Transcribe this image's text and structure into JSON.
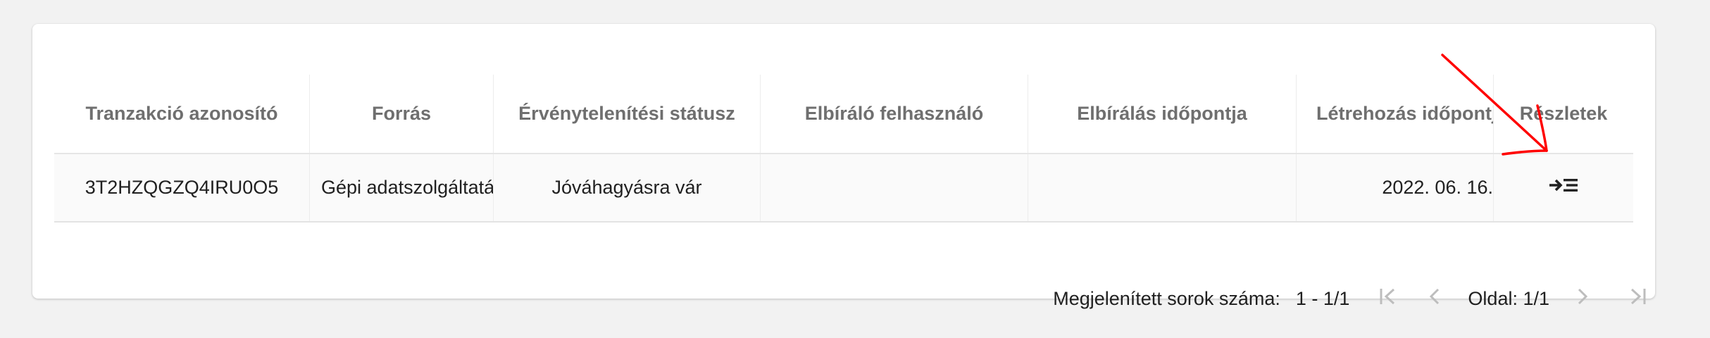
{
  "table": {
    "headers": [
      "Tranzakció azonosító",
      "Forrás",
      "Érvénytelenítési státusz",
      "Elbíráló felhasználó",
      "Elbírálás időpontja",
      "Létrehozás időpontja",
      "Részletek"
    ],
    "rows": [
      {
        "transaction_id": "3T2HZQGZQ4IRU0O5",
        "source": "Gépi adatszolgáltatás",
        "status": "Jóváhagyásra vár",
        "reviewer": "",
        "review_time": "",
        "created_time": "2022. 06. 16.",
        "details_icon": "arrow-right-list-icon"
      }
    ]
  },
  "pagination": {
    "rows_label": "Megjelenített sorok száma:",
    "range": "1 - 1/1",
    "page_label": "Oldal: 1/1"
  },
  "annotation": {
    "arrow_color": "#ff0000"
  }
}
